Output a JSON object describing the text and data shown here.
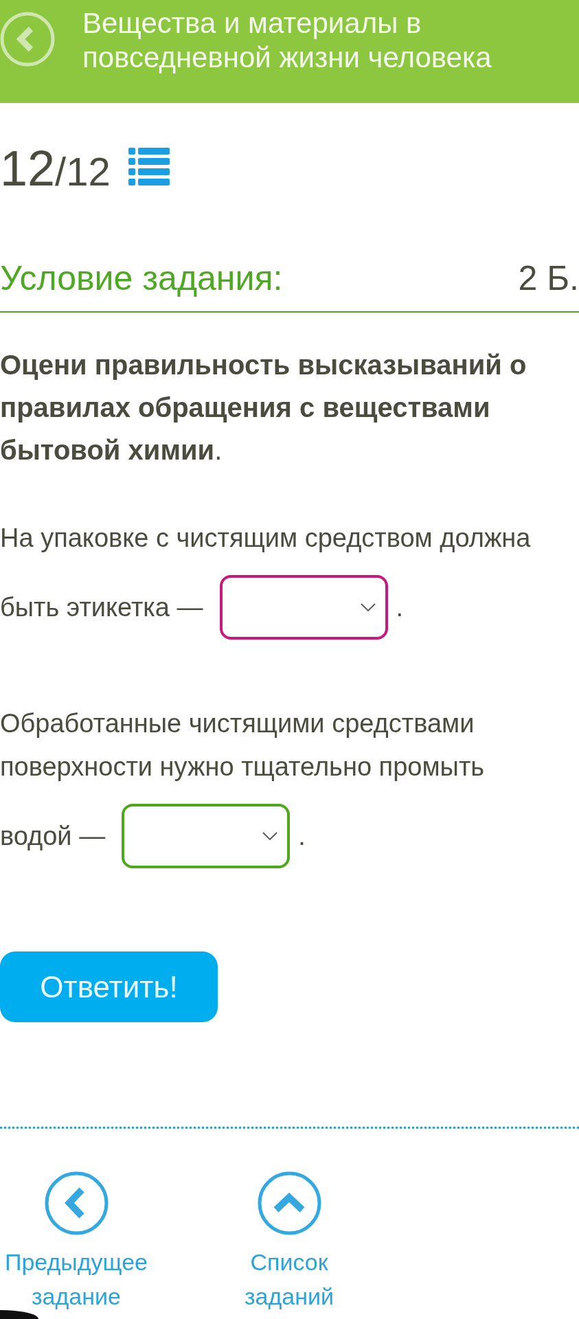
{
  "header": {
    "title": "Вещества и материалы в повседневной жизни человека"
  },
  "counter": {
    "current": "12",
    "total": "/12"
  },
  "task": {
    "heading": "Условие задания:",
    "points": "2 Б.",
    "question": "**Оцени правильность высказываний о правилах обращения с веществами бытовой химии**.",
    "statements": [
      {
        "text": "На упаковке с чистящим средством должна",
        "lead_in": "быть этикетка —",
        "dropdown": {
          "color": "#c8197f"
        },
        "after": "."
      },
      {
        "text": "Обработанные чистящими средствами поверхности нужно тщательно промыть",
        "lead_in": "водой —",
        "dropdown": {
          "color": "#4fa71f"
        },
        "after": "."
      }
    ]
  },
  "answer_button": {
    "label": "Ответить!"
  },
  "bottom_nav": [
    {
      "kind": "previous",
      "label": "Предыдущее задание"
    },
    {
      "kind": "list",
      "label": "Список заданий"
    }
  ]
}
